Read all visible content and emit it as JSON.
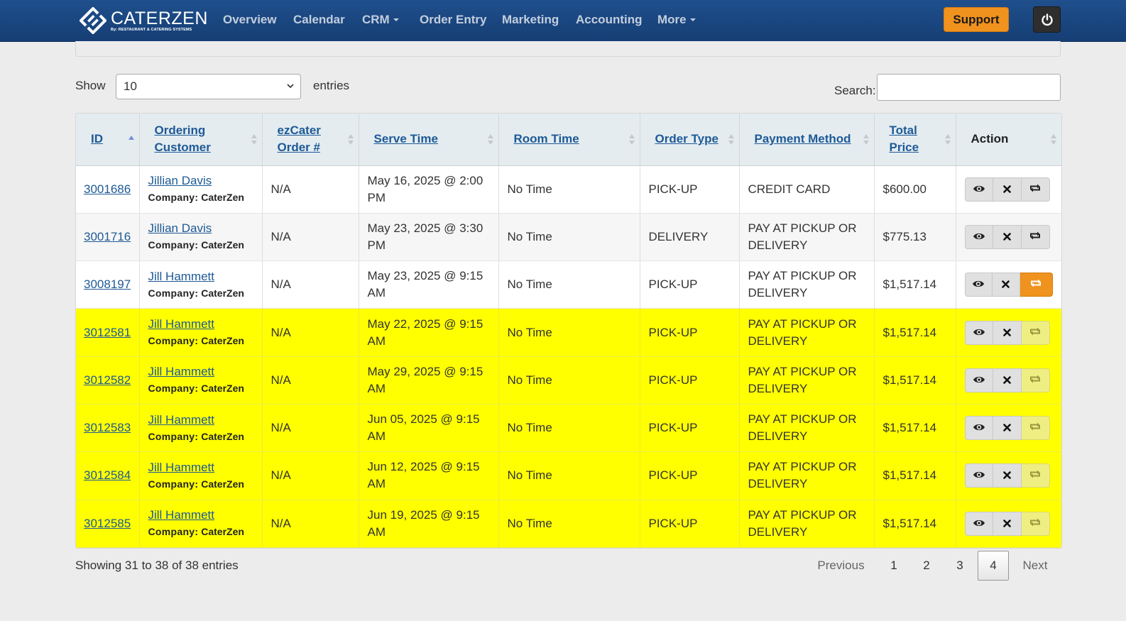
{
  "app": {
    "logo_name": "CATERZEN",
    "logo_sub": "By: RESTAURANT & CATERING SYSTEMS"
  },
  "nav": {
    "items": [
      "Overview",
      "Calendar",
      "CRM",
      "Order Entry",
      "Marketing",
      "Accounting",
      "More"
    ],
    "support_label": "Support"
  },
  "controls": {
    "show_label": "Show",
    "entries_value": "10",
    "entries_label": "entries",
    "search_label": "Search:",
    "search_value": ""
  },
  "table": {
    "columns": [
      "ID",
      "Ordering Customer",
      "ezCater Order #",
      "Serve Time",
      "Room Time",
      "Order Type",
      "Payment Method",
      "Total Price",
      "Action"
    ],
    "company_prefix": "Company:",
    "rows": [
      {
        "id": "3001686",
        "customer": "Jillian Davis",
        "company": "CaterZen",
        "ezcater": "N/A",
        "serve": "May 16, 2025 @ 2:00 PM",
        "room": "No Time",
        "type": "PICK-UP",
        "payment": "CREDIT CARD",
        "total": "$600.00",
        "highlight": "none"
      },
      {
        "id": "3001716",
        "customer": "Jillian Davis",
        "company": "CaterZen",
        "ezcater": "N/A",
        "serve": "May 23, 2025 @ 3:30 PM",
        "room": "No Time",
        "type": "DELIVERY",
        "payment": "PAY AT PICKUP OR DELIVERY",
        "total": "$775.13",
        "highlight": "none"
      },
      {
        "id": "3008197",
        "customer": "Jill Hammett",
        "company": "CaterZen",
        "ezcater": "N/A",
        "serve": "May 23, 2025 @ 9:15 AM",
        "room": "No Time",
        "type": "PICK-UP",
        "payment": "PAY AT PICKUP OR DELIVERY",
        "total": "$1,517.14",
        "highlight": "none"
      },
      {
        "id": "3012581",
        "customer": "Jill Hammett",
        "company": "CaterZen",
        "ezcater": "N/A",
        "serve": "May 22, 2025 @ 9:15 AM",
        "room": "No Time",
        "type": "PICK-UP",
        "payment": "PAY AT PICKUP OR DELIVERY",
        "total": "$1,517.14",
        "highlight": "yellow"
      },
      {
        "id": "3012582",
        "customer": "Jill Hammett",
        "company": "CaterZen",
        "ezcater": "N/A",
        "serve": "May 29, 2025 @ 9:15 AM",
        "room": "No Time",
        "type": "PICK-UP",
        "payment": "PAY AT PICKUP OR DELIVERY",
        "total": "$1,517.14",
        "highlight": "yellow"
      },
      {
        "id": "3012583",
        "customer": "Jill Hammett",
        "company": "CaterZen",
        "ezcater": "N/A",
        "serve": "Jun 05, 2025 @ 9:15 AM",
        "room": "No Time",
        "type": "PICK-UP",
        "payment": "PAY AT PICKUP OR DELIVERY",
        "total": "$1,517.14",
        "highlight": "yellow"
      },
      {
        "id": "3012584",
        "customer": "Jill Hammett",
        "company": "CaterZen",
        "ezcater": "N/A",
        "serve": "Jun 12, 2025 @ 9:15 AM",
        "room": "No Time",
        "type": "PICK-UP",
        "payment": "PAY AT PICKUP OR DELIVERY",
        "total": "$1,517.14",
        "highlight": "yellow"
      },
      {
        "id": "3012585",
        "customer": "Jill Hammett",
        "company": "CaterZen",
        "ezcater": "N/A",
        "serve": "Jun 19, 2025 @ 9:15 AM",
        "room": "No Time",
        "type": "PICK-UP",
        "payment": "PAY AT PICKUP OR DELIVERY",
        "total": "$1,517.14",
        "highlight": "yellow"
      }
    ],
    "action_icons": [
      "eye-icon",
      "close-icon",
      "repeat-icon"
    ]
  },
  "footer": {
    "info": "Showing 31 to 38 of 38 entries",
    "previous": "Previous",
    "pages": [
      "1",
      "2",
      "3",
      "4"
    ],
    "current_page": "4",
    "next": "Next"
  },
  "colors": {
    "navbar": "#1f4f8c",
    "accent_orange": "#f0921e",
    "highlight_yellow": "#ffff00",
    "link_blue": "#1e5a96"
  }
}
